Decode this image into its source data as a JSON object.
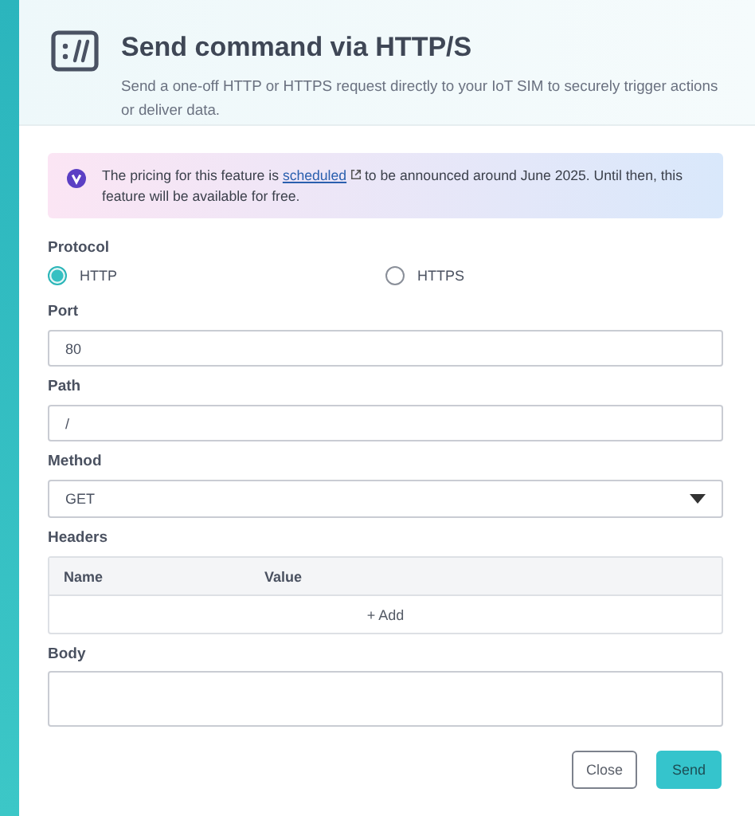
{
  "header": {
    "title": "Send command via HTTP/S",
    "description": "Send a one-off HTTP or HTTPS request directly to your IoT SIM to securely trigger actions or deliver data."
  },
  "notice": {
    "before": "The pricing for this feature is",
    "link": "scheduled",
    "after": "to be announced around June 2025. Until then, this feature will be available for free."
  },
  "protocol": {
    "label": "Protocol",
    "options": [
      {
        "label": "HTTP",
        "selected": true
      },
      {
        "label": "HTTPS",
        "selected": false
      }
    ]
  },
  "port": {
    "label": "Port",
    "value": "80"
  },
  "path": {
    "label": "Path",
    "value": "/"
  },
  "method": {
    "label": "Method",
    "value": "GET"
  },
  "headers": {
    "label": "Headers",
    "columns": [
      "Name",
      "Value"
    ],
    "add": "+ Add"
  },
  "body": {
    "label": "Body"
  },
  "buttons": [
    {
      "label": "Close",
      "kind": "secondary"
    },
    {
      "label": "Send",
      "kind": "primary"
    }
  ]
}
